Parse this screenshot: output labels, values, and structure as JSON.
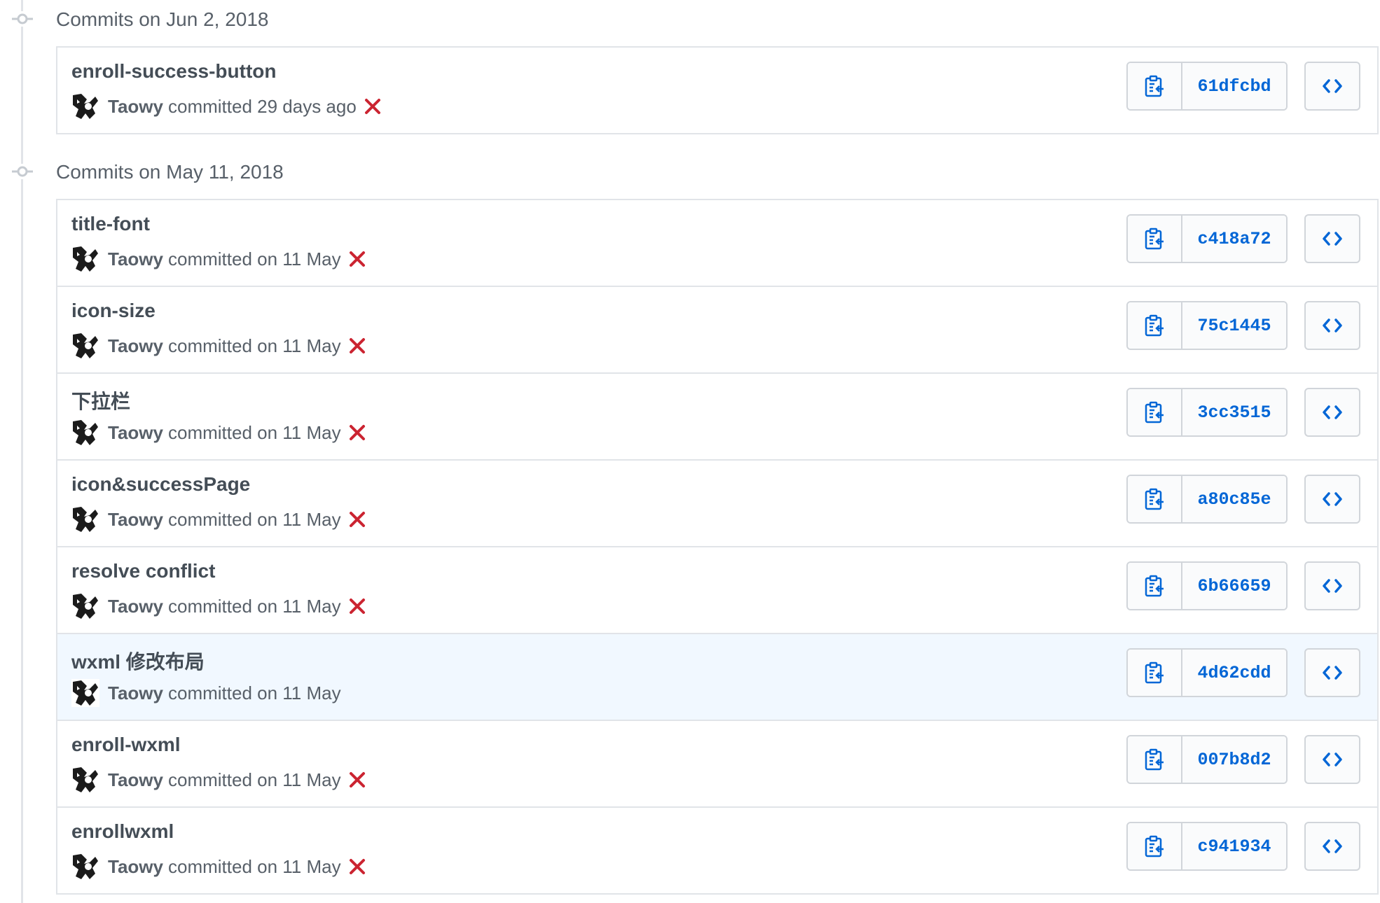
{
  "colors": {
    "sha_link": "#0366d6",
    "status_failure": "#cb2431",
    "border": "#e1e4e8",
    "highlight_row": "#f1f8ff",
    "muted_text": "#586069"
  },
  "icons": {
    "group_node": "git-commit-icon",
    "copy": "clippy-icon",
    "browse": "code-icon",
    "status": "x-icon"
  },
  "groups": [
    {
      "header": "Commits on Jun 2, 2018",
      "commits": [
        {
          "title": "enroll-success-button",
          "author": "Taowy",
          "time_text": "committed 29 days ago",
          "status": "failure",
          "sha": "61dfcbd",
          "highlighted": false
        }
      ]
    },
    {
      "header": "Commits on May 11, 2018",
      "commits": [
        {
          "title": "title-font",
          "author": "Taowy",
          "time_text": "committed on 11 May",
          "status": "failure",
          "sha": "c418a72",
          "highlighted": false
        },
        {
          "title": "icon-size",
          "author": "Taowy",
          "time_text": "committed on 11 May",
          "status": "failure",
          "sha": "75c1445",
          "highlighted": false
        },
        {
          "title": "下拉栏",
          "author": "Taowy",
          "time_text": "committed on 11 May",
          "status": "failure",
          "sha": "3cc3515",
          "highlighted": false
        },
        {
          "title": "icon&successPage",
          "author": "Taowy",
          "time_text": "committed on 11 May",
          "status": "failure",
          "sha": "a80c85e",
          "highlighted": false
        },
        {
          "title": "resolve conflict",
          "author": "Taowy",
          "time_text": "committed on 11 May",
          "status": "failure",
          "sha": "6b66659",
          "highlighted": false
        },
        {
          "title": "wxml 修改布局",
          "author": "Taowy",
          "time_text": "committed on 11 May",
          "status": "none",
          "sha": "4d62cdd",
          "highlighted": true
        },
        {
          "title": "enroll-wxml",
          "author": "Taowy",
          "time_text": "committed on 11 May",
          "status": "failure",
          "sha": "007b8d2",
          "highlighted": false
        },
        {
          "title": "enrollwxml",
          "author": "Taowy",
          "time_text": "committed on 11 May",
          "status": "failure",
          "sha": "c941934",
          "highlighted": false
        }
      ]
    }
  ]
}
